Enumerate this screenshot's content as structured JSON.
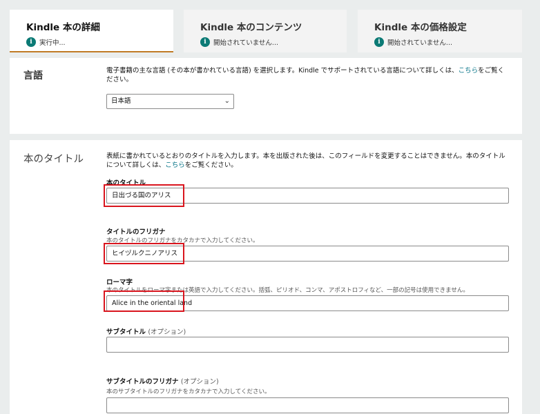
{
  "tabs": [
    {
      "title": "Kindle 本の詳細",
      "status": "実行中..."
    },
    {
      "title": "Kindle 本のコンテンツ",
      "status": "開始されていません..."
    },
    {
      "title": "Kindle 本の価格設定",
      "status": "開始されていません..."
    }
  ],
  "info_icon_glyph": "i",
  "language_section": {
    "label": "言語",
    "desc_before": "電子書籍の主な言語 (その本が書かれている言語) を選択します。Kindle でサポートされている言語について詳しくは、",
    "desc_link": "こちら",
    "desc_after": "をご覧ください。",
    "selected_language": "日本語"
  },
  "title_section": {
    "label": "本のタイトル",
    "desc_before": "表紙に書かれているとおりのタイトルを入力します。本を出版された後は、このフィールドを変更することはできません。本のタイトルについて詳しくは、",
    "desc_link": "こちら",
    "desc_after": "をご覧ください。",
    "fields": {
      "title": {
        "label": "本のタイトル",
        "value": "日出づる国のアリス"
      },
      "furigana": {
        "label": "タイトルのフリガナ",
        "help": "本のタイトルのフリガナをカタカナで入力してください。",
        "value": "ヒイヅルクニノアリス"
      },
      "romaji": {
        "label": "ローマ字",
        "help": "本のタイトルをローマ字または英語で入力してください。括弧、ピリオド、コンマ、アポストロフィなど、一部の記号は使用できません。",
        "value": "Alice in the oriental land"
      },
      "subtitle": {
        "label": "サブタイトル",
        "optional": "(オプション)",
        "value": ""
      },
      "subtitle_furigana": {
        "label": "サブタイトルのフリガナ",
        "optional": "(オプション)",
        "help": "本のサブタイトルのフリガナをカタカナで入力してください。",
        "value": ""
      }
    }
  },
  "colors": {
    "accent_tab_underline": "#c07a24",
    "info_icon": "#0b7a75",
    "link": "#007185",
    "highlight_box": "#d9141d"
  }
}
